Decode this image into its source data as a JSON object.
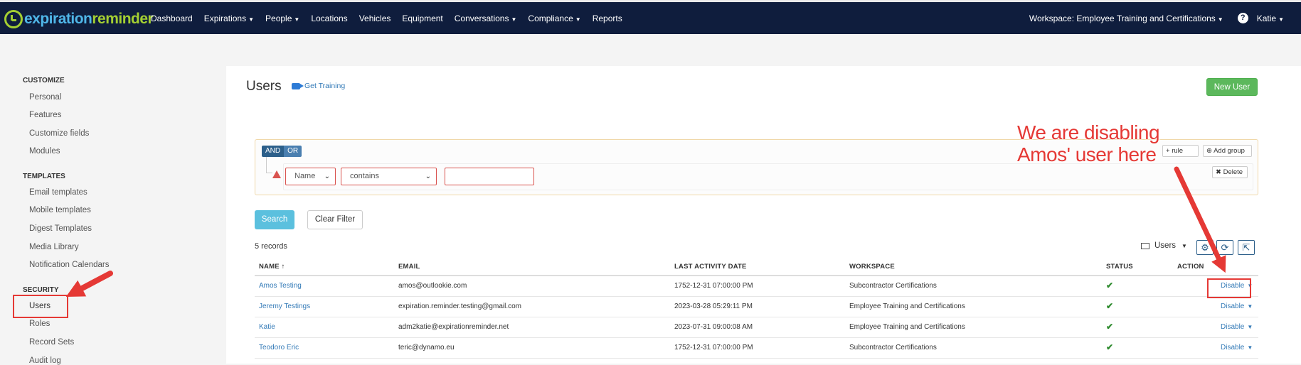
{
  "brand": {
    "part1": "expiration",
    "part2": "reminder"
  },
  "nav": {
    "items": [
      {
        "label": "Dashboard",
        "dropdown": false
      },
      {
        "label": "Expirations",
        "dropdown": true
      },
      {
        "label": "People",
        "dropdown": true
      },
      {
        "label": "Locations",
        "dropdown": false
      },
      {
        "label": "Vehicles",
        "dropdown": false
      },
      {
        "label": "Equipment",
        "dropdown": false
      },
      {
        "label": "Conversations",
        "dropdown": true
      },
      {
        "label": "Compliance",
        "dropdown": true
      },
      {
        "label": "Reports",
        "dropdown": false
      }
    ],
    "workspace": "Workspace: Employee Training and Certifications",
    "help": "?",
    "user": "Katie"
  },
  "sidebar": {
    "customize_heading": "CUSTOMIZE",
    "customize": [
      "Personal",
      "Features",
      "Customize fields",
      "Modules"
    ],
    "templates_heading": "TEMPLATES",
    "templates": [
      "Email templates",
      "Mobile templates",
      "Digest Templates",
      "Media Library",
      "Notification Calendars"
    ],
    "security_heading": "SECURITY",
    "security": [
      "Users",
      "Roles",
      "Record Sets",
      "Audit log"
    ]
  },
  "page": {
    "title": "Users",
    "get_training": "Get Training",
    "new_user": "New User"
  },
  "filter": {
    "and": "AND",
    "or": "OR",
    "add_rule": "rule",
    "add_group": "Add group",
    "delete": "Delete",
    "field": "Name",
    "operator": "contains",
    "value": ""
  },
  "actions": {
    "search": "Search",
    "clear": "Clear Filter"
  },
  "records": "5 records",
  "view_selector": "Users",
  "table": {
    "headers": {
      "name": "NAME ↑",
      "email": "EMAIL",
      "last_activity": "LAST ACTIVITY DATE",
      "workspace": "WORKSPACE",
      "status": "STATUS",
      "action": "ACTION"
    },
    "rows": [
      {
        "name": "Amos Testing",
        "email": "amos@outlookie.com",
        "last_activity": "1752-12-31 07:00:00 PM",
        "workspace": "Subcontractor Certifications",
        "status": "active",
        "action": "Disable"
      },
      {
        "name": "Jeremy Testings",
        "email": "expiration.reminder.testing@gmail.com",
        "last_activity": "2023-03-28 05:29:11 PM",
        "workspace": "Employee Training and Certifications",
        "status": "active",
        "action": "Disable"
      },
      {
        "name": "Katie",
        "email": "adm2katie@expirationreminder.net",
        "last_activity": "2023-07-31 09:00:08 AM",
        "workspace": "Employee Training and Certifications",
        "status": "active",
        "action": "Disable"
      },
      {
        "name": "Teodoro Eric",
        "email": "teric@dynamo.eu",
        "last_activity": "1752-12-31 07:00:00 PM",
        "workspace": "Subcontractor Certifications",
        "status": "active",
        "action": "Disable"
      }
    ]
  },
  "annotation": {
    "line1": "We are disabling",
    "line2": "Amos' user here"
  },
  "colors": {
    "topbar": "#0f1d3d",
    "accent": "#337ab7",
    "highlight": "#e53935",
    "success": "#5cb85c"
  }
}
